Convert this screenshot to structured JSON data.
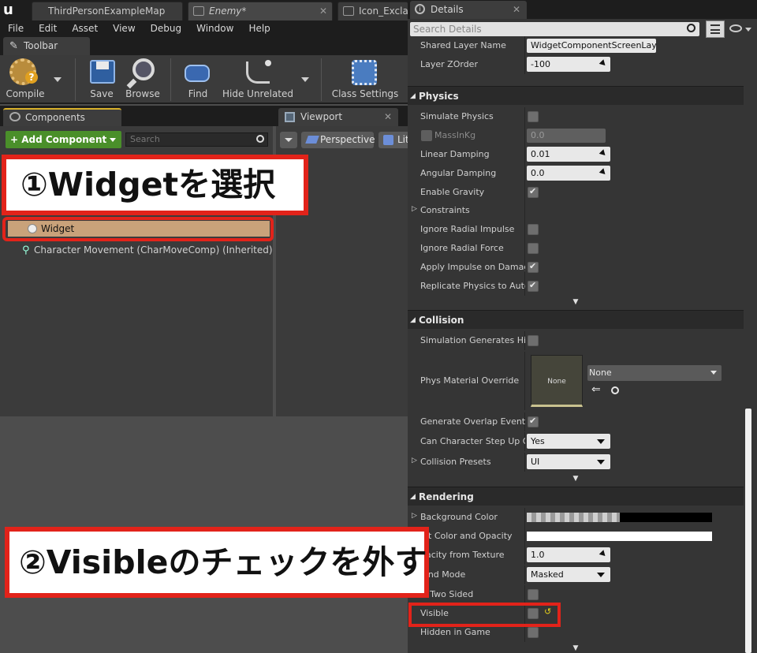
{
  "tabs": [
    {
      "label": "ThirdPersonExampleMap"
    },
    {
      "label": "Enemy*"
    },
    {
      "label": "Icon_Exclar"
    }
  ],
  "menu": [
    "File",
    "Edit",
    "Asset",
    "View",
    "Debug",
    "Window",
    "Help"
  ],
  "toolbar": {
    "title": "Toolbar",
    "buttons": {
      "compile": "Compile",
      "save": "Save",
      "browse": "Browse",
      "find": "Find",
      "hide_unrelated": "Hide Unrelated",
      "class_settings": "Class Settings"
    }
  },
  "components": {
    "title": "Components",
    "add_button": "+ Add Component",
    "search_placeholder": "Search",
    "items": [
      "Widget",
      "Character Movement (CharMoveComp) (Inherited)"
    ]
  },
  "viewport": {
    "title": "Viewport",
    "perspective": "Perspective",
    "lit": "Lit"
  },
  "details": {
    "title": "Details",
    "search_placeholder": "Search Details",
    "top_rows": [
      {
        "label": "Shared Layer Name",
        "value": "WidgetComponentScreenLayer"
      },
      {
        "label": "Layer ZOrder",
        "value": "-100"
      }
    ],
    "physics": {
      "title": "Physics",
      "simulate": "Simulate Physics",
      "mass": "MassInKg",
      "mass_value": "0.0",
      "linear": "Linear Damping",
      "linear_value": "0.01",
      "angular": "Angular Damping",
      "angular_value": "0.0",
      "gravity": "Enable Gravity",
      "constraints": "Constraints",
      "radial": "Ignore Radial Impulse",
      "radial_force": "Ignore Radial Force",
      "apply": "Apply Impulse on Damage",
      "replicate": "Replicate Physics to Autor"
    },
    "collision": {
      "title": "Collision",
      "sim_hit": "Simulation Generates Hit E",
      "phys_mat": "Phys Material Override",
      "thumb": "None",
      "phys_value": "None",
      "overlap": "Generate Overlap Events",
      "step": "Can Character Step Up On",
      "step_value": "Yes",
      "presets": "Collision Presets",
      "presets_value": "UI"
    },
    "rendering": {
      "title": "Rendering",
      "bg": "Background Color",
      "tint": "int Color and Opacity",
      "opacity": "pacity from Texture",
      "opacity_value": "1.0",
      "blend": "lend Mode",
      "blend_value": "Masked",
      "two_sided": "ls Two Sided",
      "visible": "Visible",
      "hidden": "Hidden in Game"
    }
  },
  "annotations": {
    "step1": "①Widgetを選択",
    "step2": "②Visibleのチェックを外す"
  },
  "colors": {
    "accent_red": "#e2231a",
    "add_green": "#4a8f2a",
    "selection": "#c9a27a"
  }
}
